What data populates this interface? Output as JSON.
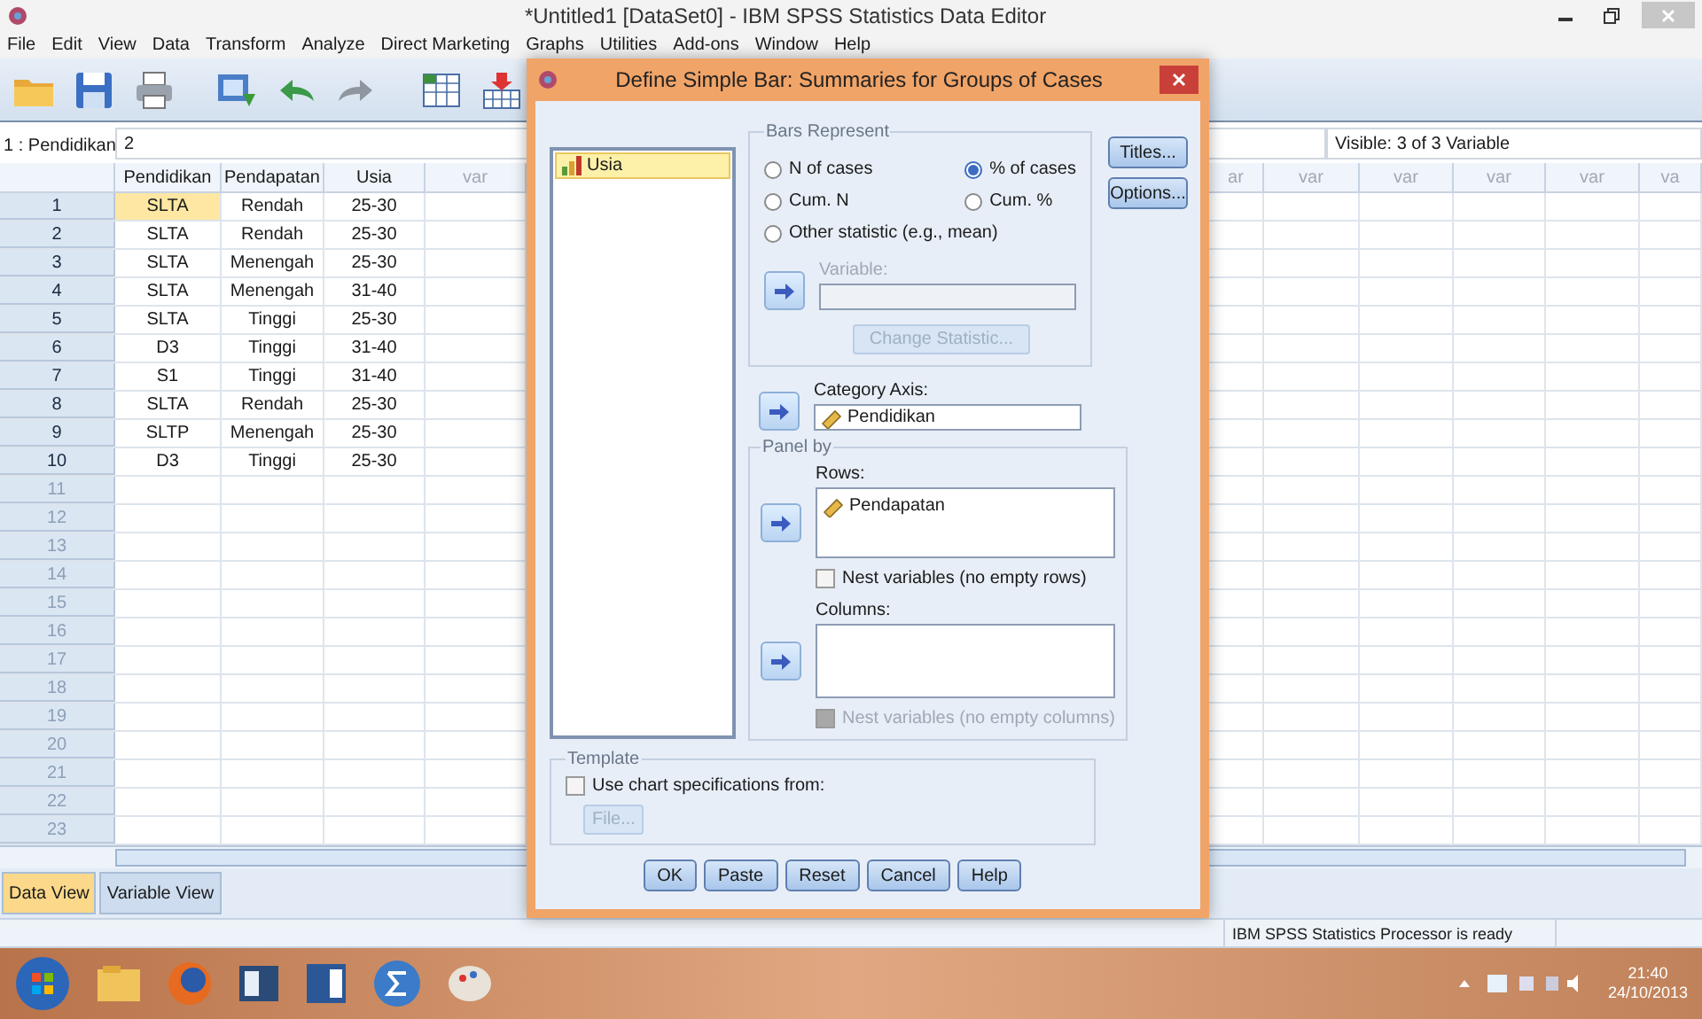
{
  "window": {
    "title": "*Untitled1 [DataSet0] - IBM SPSS Statistics Data Editor"
  },
  "menu": [
    "File",
    "Edit",
    "View",
    "Data",
    "Transform",
    "Analyze",
    "Direct Marketing",
    "Graphs",
    "Utilities",
    "Add-ons",
    "Window",
    "Help"
  ],
  "cell_editor": {
    "cell": "1 : Pendidikan",
    "value": "2",
    "visible": "Visible: 3 of 3 Variable"
  },
  "grid": {
    "left_columns": [
      "Pendidikan",
      "Pendapatan",
      "Usia",
      "var"
    ],
    "right_columns": [
      "ar",
      "var",
      "var",
      "var",
      "var",
      "va"
    ],
    "rows": [
      {
        "number": "1",
        "cells": [
          {
            "text": "SLTA",
            "selected": true
          },
          {
            "text": "Rendah",
            "selected": false
          },
          {
            "text": "25-30",
            "selected": false
          }
        ]
      },
      {
        "number": "2",
        "cells": [
          {
            "text": "SLTA",
            "selected": false
          },
          {
            "text": "Rendah",
            "selected": false
          },
          {
            "text": "25-30",
            "selected": false
          }
        ]
      },
      {
        "number": "3",
        "cells": [
          {
            "text": "SLTA",
            "selected": false
          },
          {
            "text": "Menengah",
            "selected": false
          },
          {
            "text": "25-30",
            "selected": false
          }
        ]
      },
      {
        "number": "4",
        "cells": [
          {
            "text": "SLTA",
            "selected": false
          },
          {
            "text": "Menengah",
            "selected": false
          },
          {
            "text": "31-40",
            "selected": false
          }
        ]
      },
      {
        "number": "5",
        "cells": [
          {
            "text": "SLTA",
            "selected": false
          },
          {
            "text": "Tinggi",
            "selected": false
          },
          {
            "text": "25-30",
            "selected": false
          }
        ]
      },
      {
        "number": "6",
        "cells": [
          {
            "text": "D3",
            "selected": false
          },
          {
            "text": "Tinggi",
            "selected": false
          },
          {
            "text": "31-40",
            "selected": false
          }
        ]
      },
      {
        "number": "7",
        "cells": [
          {
            "text": "S1",
            "selected": false
          },
          {
            "text": "Tinggi",
            "selected": false
          },
          {
            "text": "31-40",
            "selected": false
          }
        ]
      },
      {
        "number": "8",
        "cells": [
          {
            "text": "SLTA",
            "selected": false
          },
          {
            "text": "Rendah",
            "selected": false
          },
          {
            "text": "25-30",
            "selected": false
          }
        ]
      },
      {
        "number": "9",
        "cells": [
          {
            "text": "SLTP",
            "selected": false
          },
          {
            "text": "Menengah",
            "selected": false
          },
          {
            "text": "25-30",
            "selected": false
          }
        ]
      },
      {
        "number": "10",
        "cells": [
          {
            "text": "D3",
            "selected": false
          },
          {
            "text": "Tinggi",
            "selected": false
          },
          {
            "text": "25-30",
            "selected": false
          }
        ]
      },
      {
        "number": "11"
      },
      {
        "number": "12"
      },
      {
        "number": "13"
      },
      {
        "number": "14"
      },
      {
        "number": "15"
      },
      {
        "number": "16"
      },
      {
        "number": "17"
      },
      {
        "number": "18"
      },
      {
        "number": "19"
      },
      {
        "number": "20"
      },
      {
        "number": "21"
      },
      {
        "number": "22"
      },
      {
        "number": "23"
      }
    ]
  },
  "tabs": [
    {
      "label": "Data View",
      "selected": true
    },
    {
      "label": "Variable View",
      "selected": false
    }
  ],
  "status_bar": "IBM SPSS Statistics Processor is ready",
  "taskbar": {
    "time": "21:40",
    "date": "24/10/2013"
  },
  "dialog": {
    "title": "Define Simple Bar: Summaries for Groups of Cases",
    "variables": [
      {
        "name": "Usia",
        "selected": true
      }
    ],
    "bars_represent": {
      "title": "Bars Represent",
      "options": [
        {
          "label": "N of cases",
          "selected": false
        },
        {
          "label": "% of cases",
          "selected": true
        },
        {
          "label": "Cum. N",
          "selected": false
        },
        {
          "label": "Cum. %",
          "selected": false
        },
        {
          "label": "Other statistic (e.g., mean)",
          "selected": false
        }
      ],
      "variable": {
        "label": "Variable:",
        "disabled": true
      },
      "change_statistic": {
        "label": "Change Statistic...",
        "disabled": true
      }
    },
    "category_axis": {
      "label": "Category Axis:",
      "value": "Pendidikan"
    },
    "panel_by": {
      "title": "Panel by",
      "rows_label": "Rows:",
      "rows": [
        "Pendapatan"
      ],
      "nest_rows": {
        "label": "Nest variables (no empty rows)",
        "checked": false,
        "disabled": false
      },
      "columns_label": "Columns:",
      "nest_columns": {
        "label": "Nest variables (no empty columns)",
        "checked": false,
        "disabled": true
      }
    },
    "template": {
      "title": "Template",
      "use": {
        "label": "Use chart specifications from:",
        "checked": false
      },
      "file_button": {
        "label": "File...",
        "disabled": true
      }
    },
    "side_buttons": [
      "Titles...",
      "Options..."
    ],
    "buttons": [
      "OK",
      "Paste",
      "Reset",
      "Cancel",
      "Help"
    ]
  }
}
